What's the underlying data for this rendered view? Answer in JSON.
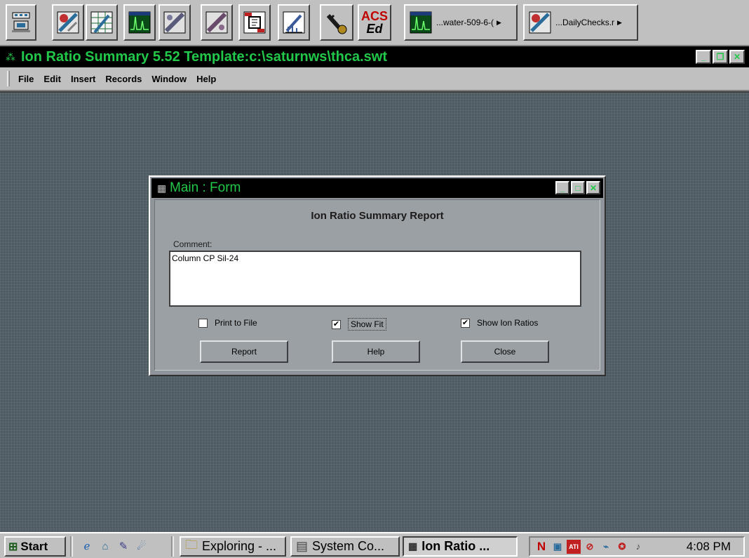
{
  "toolbar": {
    "tools": [
      {
        "icon": "workstation-icon",
        "color": "#2a6c9a"
      },
      {
        "icon": "calibration-icon",
        "color": "#a03030"
      },
      {
        "icon": "spreadsheet-icon",
        "color": "#1d6b3a"
      },
      {
        "icon": "chromatogram-icon",
        "color": "#0a5e20"
      },
      {
        "icon": "ms-standard-icon",
        "color": "#5a5a7a"
      },
      {
        "icon": "ms-custom-icon",
        "color": "#6a4a6a"
      },
      {
        "icon": "ms-sample-icon",
        "color": "#8a2020"
      },
      {
        "icon": "syringe-icon",
        "color": "#3a5a9a"
      },
      {
        "icon": "key-icon",
        "color": "#b08a20"
      }
    ],
    "acs_label_top": "ACS",
    "acs_label_bottom": "Ed",
    "file1_label": "...water-509-6-(",
    "file2_label": "...DailyChecks.r"
  },
  "window": {
    "title": "Ion Ratio Summary 5.52 Template:c:\\saturnws\\thca.swt"
  },
  "menu": [
    "File",
    "Edit",
    "Insert",
    "Records",
    "Window",
    "Help"
  ],
  "dialog": {
    "title": "Main : Form",
    "heading": "Ion Ratio Summary Report",
    "comment_label": "Comment:",
    "comment_value": "Column CP Sil-24",
    "checkboxes": [
      {
        "label": "Print to File",
        "checked": false
      },
      {
        "label": "Show Fit",
        "checked": true
      },
      {
        "label": "Show Ion Ratios",
        "checked": true
      }
    ],
    "buttons": {
      "report": "Report",
      "help": "Help",
      "close": "Close"
    }
  },
  "taskbar": {
    "start": "Start",
    "tasks": [
      "Exploring - ...",
      "System Co...",
      "Ion Ratio ..."
    ],
    "clock": "4:08 PM",
    "tray_letter": "N"
  }
}
